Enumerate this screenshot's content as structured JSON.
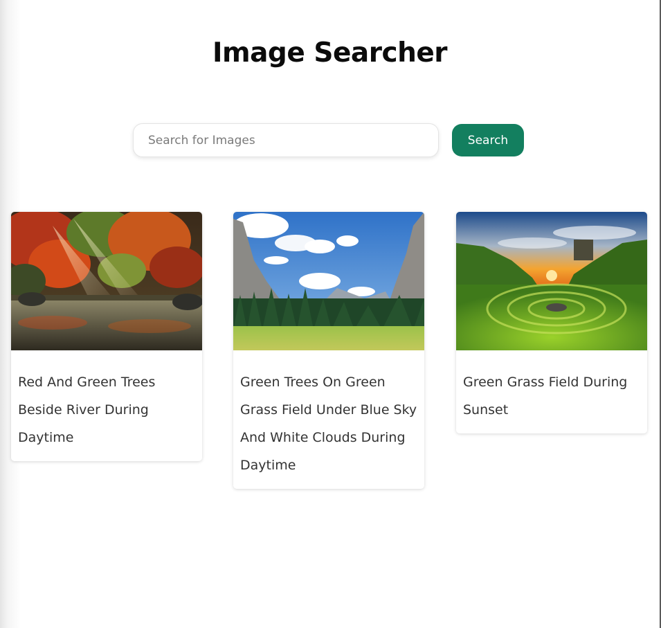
{
  "header": {
    "title": "Image Searcher"
  },
  "search": {
    "placeholder": "Search for Images",
    "value": "",
    "button_label": "Search"
  },
  "results": [
    {
      "caption": "Red And Green Trees Beside River During Daytime"
    },
    {
      "caption": "Green Trees On Green Grass Field Under Blue Sky And White Clouds During Daytime"
    },
    {
      "caption": "Green Grass Field During Sunset"
    }
  ],
  "colors": {
    "accent": "#137f5f",
    "title": "#0b0b0b",
    "caption": "#333333"
  }
}
